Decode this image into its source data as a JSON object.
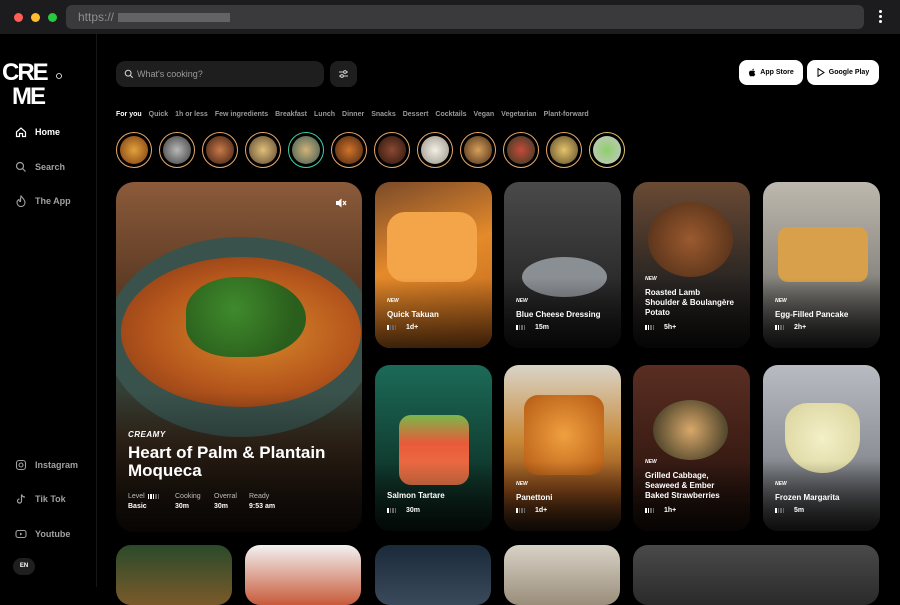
{
  "browser": {
    "url_prefix": "https://"
  },
  "brand": {
    "logo_text": "CRE ME"
  },
  "sidebar": {
    "items": [
      {
        "label": "Home",
        "icon": "home-icon"
      },
      {
        "label": "Search",
        "icon": "search-icon"
      },
      {
        "label": "The App",
        "icon": "flame-icon"
      }
    ],
    "social": [
      {
        "label": "Instagram",
        "icon": "instagram-icon"
      },
      {
        "label": "Tik Tok",
        "icon": "tiktok-icon"
      },
      {
        "label": "Youtube",
        "icon": "youtube-icon"
      }
    ],
    "language": "EN"
  },
  "search": {
    "placeholder": "What's cooking?"
  },
  "stores": {
    "app_store": "App Store",
    "google_play": "Google Play"
  },
  "categories": [
    "For you",
    "Quick",
    "1h or less",
    "Few ingredients",
    "Breakfast",
    "Lunch",
    "Dinner",
    "Snacks",
    "Dessert",
    "Cocktails",
    "Vegan",
    "Vegetarian",
    "Plant-forward"
  ],
  "hero": {
    "tag": "CREAMY",
    "title": "Heart of Palm & Plantain Moqueca",
    "meta": [
      {
        "key": "Level",
        "value": "Basic",
        "bar": true
      },
      {
        "key": "Cooking",
        "value": "30m"
      },
      {
        "key": "Overral",
        "value": "30m"
      },
      {
        "key": "Ready",
        "value": "9:53 am"
      }
    ]
  },
  "recipes": [
    {
      "badge": "NEW",
      "title": "Quick Takuan",
      "duration": "1d+"
    },
    {
      "badge": "NEW",
      "title": "Blue Cheese Dressing",
      "duration": "15m"
    },
    {
      "badge": "NEW",
      "title": "Roasted Lamb Shoulder & Boulangère Potato",
      "duration": "5h+"
    },
    {
      "badge": "NEW",
      "title": "Egg-Filled Pancake",
      "duration": "2h+"
    },
    {
      "badge": "",
      "title": "Salmon Tartare",
      "duration": "30m"
    },
    {
      "badge": "NEW",
      "title": "Panettoni",
      "duration": "1d+"
    },
    {
      "badge": "NEW",
      "title": "Grilled Cabbage, Seaweed & Ember Baked Strawberries",
      "duration": "1h+"
    },
    {
      "badge": "NEW",
      "title": "Frozen Margarita",
      "duration": "5m"
    }
  ],
  "colors": {
    "accent_ring": "#e8a86a",
    "active_ring": "#3ecfa5",
    "background": "#000000"
  }
}
